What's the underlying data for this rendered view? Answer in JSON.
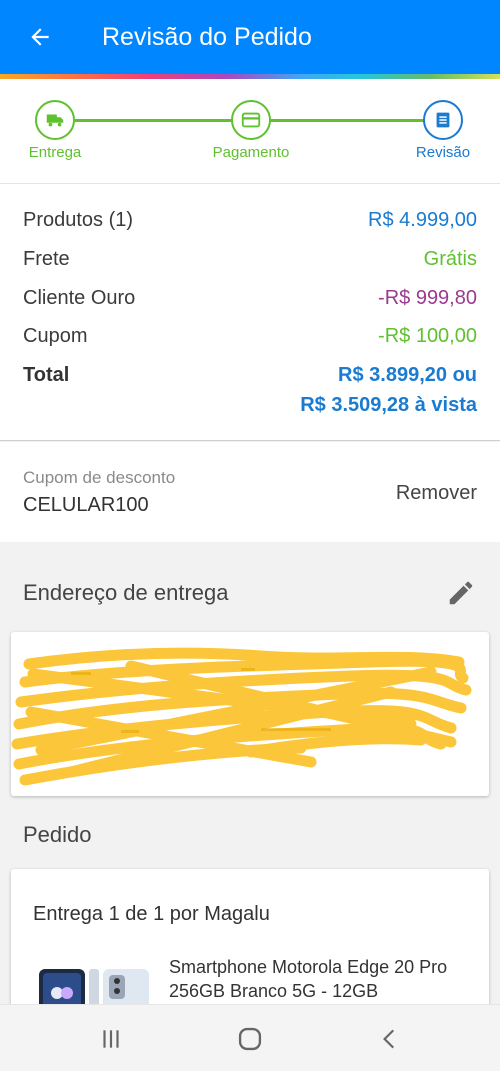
{
  "header": {
    "title": "Revisão do Pedido"
  },
  "steps": [
    {
      "label": "Entrega",
      "icon": "truck-icon",
      "state": "done"
    },
    {
      "label": "Pagamento",
      "icon": "card-icon",
      "state": "done"
    },
    {
      "label": "Revisão",
      "icon": "receipt-icon",
      "state": "current"
    }
  ],
  "summary": {
    "products_label": "Produtos (1)",
    "products_value": "R$ 4.999,00",
    "shipping_label": "Frete",
    "shipping_value": "Grátis",
    "gold_label": "Cliente Ouro",
    "gold_value": "-R$ 999,80",
    "coupon_label": "Cupom",
    "coupon_value": "-R$ 100,00",
    "total_label": "Total",
    "total_value_line1": "R$ 3.899,20 ou",
    "total_value_line2": "R$ 3.509,28 à vista"
  },
  "coupon": {
    "caption": "Cupom de desconto",
    "code": "CELULAR100",
    "remove_label": "Remover"
  },
  "address": {
    "title": "Endereço de entrega"
  },
  "order": {
    "title": "Pedido",
    "delivery_header": "Entrega 1 de 1 por Magalu",
    "product_name": "Smartphone Motorola Edge 20 Pro 256GB Branco 5G - 12GB"
  },
  "colors": {
    "primary": "#0086ff",
    "green": "#5fc12f",
    "blue_text": "#1a7bd1",
    "purple": "#9b3a8f",
    "redaction": "#fbc63a"
  }
}
